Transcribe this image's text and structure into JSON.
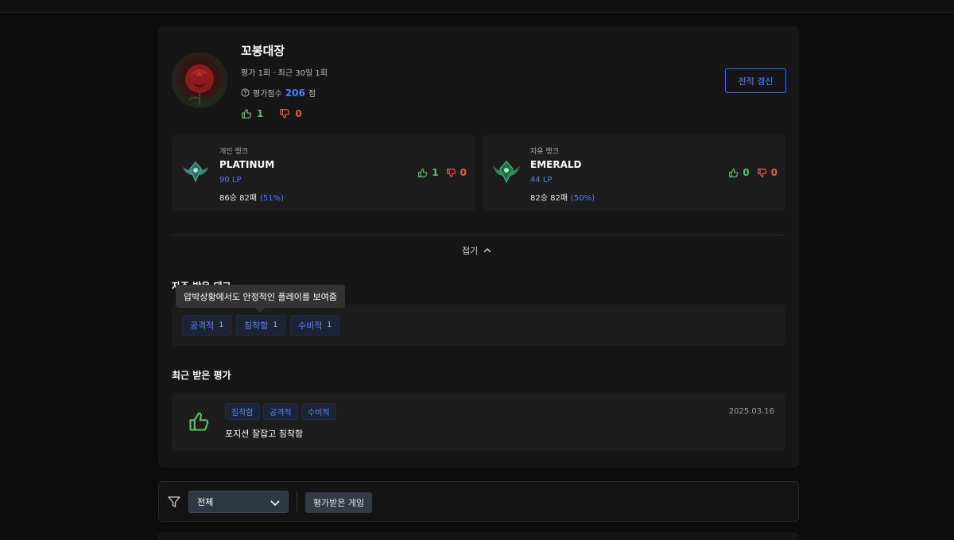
{
  "profile": {
    "name": "꼬봉대장",
    "summary": "평가 1회 · 최근 30일 1회",
    "score_label": "평가점수",
    "score_value": "206",
    "score_unit": "점",
    "likes": "1",
    "dislikes": "0",
    "refresh_label": "전적 갱신"
  },
  "ranks": [
    {
      "queue": "개인 랭크",
      "tier": "PLATINUM",
      "lp": "90 LP",
      "record": "86승 82패",
      "winrate": "(51%)",
      "likes": "1",
      "dislikes": "0",
      "emblem": "platinum-emblem-icon"
    },
    {
      "queue": "자유 랭크",
      "tier": "EMERALD",
      "lp": "44 LP",
      "record": "82승 82패",
      "winrate": "(50%)",
      "likes": "0",
      "dislikes": "0",
      "emblem": "emerald-emblem-icon"
    }
  ],
  "collapse_label": "접기",
  "tags_section": {
    "title": "자주 받은 태그",
    "tooltip": "압박상황에서도 안정적인 플레이를 보여줌",
    "tags": [
      {
        "label": "공격적",
        "count": "1"
      },
      {
        "label": "침착함",
        "count": "1"
      },
      {
        "label": "수비적",
        "count": "1"
      }
    ]
  },
  "recent_section": {
    "title": "최근 받은 평가",
    "review": {
      "tags": [
        "침착함",
        "공격적",
        "수비적"
      ],
      "date": "2025.03.16",
      "comment": "포지션 잘잡고 침착함"
    }
  },
  "filter": {
    "selected": "전체",
    "game_button": "평가받은 게임"
  },
  "colors": {
    "accent": "#4f7dff",
    "like": "#5cc26a",
    "dislike": "#ef5a4d",
    "card": "#161616",
    "background": "#0c0c0c"
  }
}
